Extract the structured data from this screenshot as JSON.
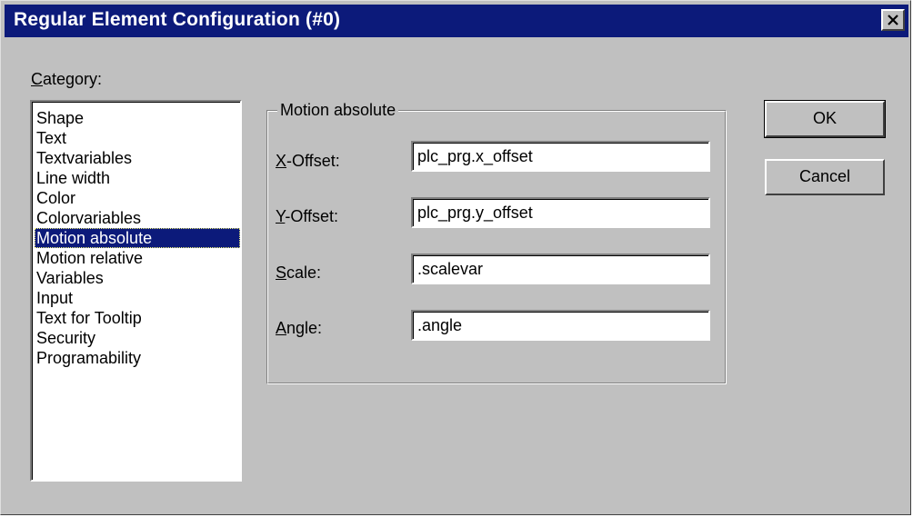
{
  "window": {
    "title": "Regular Element Configuration (#0)",
    "titlebar_color": "#0c1a7a",
    "close_icon": "close-icon"
  },
  "category": {
    "label_accel": "C",
    "label_rest": "ategory:",
    "items": [
      "Shape",
      "Text",
      "Textvariables",
      "Line width",
      "Color",
      "Colorvariables",
      "Motion absolute",
      "Motion relative",
      "Variables",
      "Input",
      "Text for Tooltip",
      "Security",
      "Programability"
    ],
    "selected": "Motion absolute"
  },
  "group": {
    "title": "Motion absolute"
  },
  "fields": {
    "x_offset": {
      "label_accel": "X",
      "label_rest": "-Offset:",
      "value": "plc_prg.x_offset"
    },
    "y_offset": {
      "label_accel": "Y",
      "label_rest": "-Offset:",
      "value": "plc_prg.y_offset"
    },
    "scale": {
      "label_accel": "S",
      "label_rest": "cale:",
      "value": ".scalevar"
    },
    "angle": {
      "label_accel": "A",
      "label_rest": "ngle:",
      "value": ".angle"
    }
  },
  "buttons": {
    "ok": "OK",
    "cancel": "Cancel"
  }
}
